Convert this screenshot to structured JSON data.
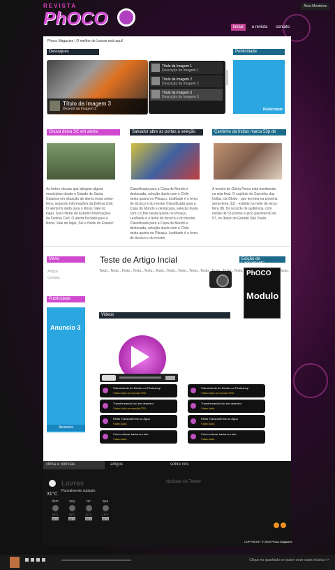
{
  "topbar": {
    "link": "Área Membros"
  },
  "logo": {
    "small": "REVISTA",
    "big": "PhOCO"
  },
  "nav": {
    "items": [
      "inicial",
      "a revista",
      "contato"
    ]
  },
  "tagline": "Phoco Magazine | O melhor de Lavras está aqui!",
  "destaques": {
    "header": "Destaques",
    "main": {
      "title": "Título da Imagem 3",
      "desc": "Desertó da Imagem 3"
    },
    "list": [
      {
        "title": "Título da Imagem 1",
        "desc": "Descrição da Imagem 1"
      },
      {
        "title": "Título da Imagem 2",
        "desc": "Descrição da Imagem 2"
      },
      {
        "title": "Título da Imagem 3",
        "desc": "Descrição da Imagem 3"
      }
    ]
  },
  "publicidade": {
    "header": "Publicidade",
    "label": "Publicidade"
  },
  "news": [
    {
      "header": "Chuva deixa SC em alerta",
      "text": "As fortes chuvas que atingem alguns municípios desde o Estado de Santa Catarina em situação de alerta nesta sexta-feira, segundo informações da Defesa Civil. O alerta foi dado para o litoral, Vale do Itajaí, Sul e Norte do Estado! informações da Defesa Civil. O alerta foi dado para o litoral, Vale do Itajaí, Sul e Norte do Estado!"
    },
    {
      "header": "Salvador abre as portas à seleção",
      "text": "Classificada para a Copa do Mundo e destacada, seleção duela com o Chile nesta quarta no Pituaçu. Leafdade é o lema do técnico é do mestre Classificada para a Copa do Mundo e destacada, seleção duela com o Chile nesta quarta no Pituaçu. Leafdade é o lema do técnico e do mestre Classificada para a Copa do Mundo e destacada, seleção duela com o Chile nesta quarta no Pituaçu. Leafdade é o lema do técnico e do mestre"
    },
    {
      "header": "Caminho da Índias marca 53p de",
      "text": "A novela de Glória Perez está bombando, na reta final. O capítulo de Caminho das Índias, da Globo - que termina na próxima sexta-feira (11) - exibido na noite de terça-feira (8), foi recorde de audiência, com média de 53 pontos e pico (pavimenti) de 57, no Ibope da Grande São Paulo."
    }
  ],
  "menu": {
    "header": "Menu",
    "items": [
      "Artigos",
      "Contato"
    ]
  },
  "article": {
    "title": "Teste de Artigo Incial",
    "body": "Texto...Texto...Texto...Texto...Texto...Texto...Texto...Texto...Texto...Texto...Texto...Texto...Texto...Texto...Texto...Texto...Texto..."
  },
  "edicao": {
    "header": "Edição de Lançamento",
    "cover_title": "PhOCO",
    "cover_sub": "Modulo"
  },
  "publicidade2": {
    "header": "Publicidade",
    "ad_title": "Anuncio 3",
    "ad_label": "Anuncios"
  },
  "videos": {
    "header": "Videos",
    "items": [
      {
        "title": "Clareamento de Dentes no Photoshop",
        "desc": "Vídeo Aula na versão CS3"
      },
      {
        "title": "Clareamento de Dentes no Photoshop",
        "desc": "Vídeo Aula na versão CS3"
      },
      {
        "title": "Transformando foto em desenho",
        "desc": "Vídeo Aula na versão CS3"
      },
      {
        "title": "Transformando foto em desenho",
        "desc": "Vídeo Aula"
      },
      {
        "title": "Efeito Transparência na Água",
        "desc": "Vídeo Aula"
      },
      {
        "title": "Efeito Transparência na Água",
        "desc": "Vídeo Aula"
      },
      {
        "title": "Como colocar barba em foto",
        "desc": "Vídeo Aula"
      },
      {
        "title": "Como colocar barba em foto",
        "desc": "Vídeo Aula"
      }
    ]
  },
  "footer": {
    "tabs": [
      "clima e notícias",
      "artigos",
      "sobre nós"
    ],
    "weather": {
      "city": "Lavras",
      "condition": "Parcialmente nublado",
      "temp": "31°C",
      "days": [
        {
          "name": "dom",
          "lo": "20°C",
          "hi": "31°C"
        },
        {
          "name": "seg",
          "lo": "20°C",
          "hi": "28°C"
        },
        {
          "name": "ter",
          "lo": "21°C",
          "hi": "34°C"
        },
        {
          "name": "qua",
          "lo": "19°C",
          "hi": "33°C"
        }
      ]
    },
    "twitter": "Notícias via Twitter",
    "copyright": "COPYRIGHT © 2009 Phoco Magazine"
  },
  "player": {
    "message": "Clique no quadrado se quiser ouvir outra música >>"
  }
}
